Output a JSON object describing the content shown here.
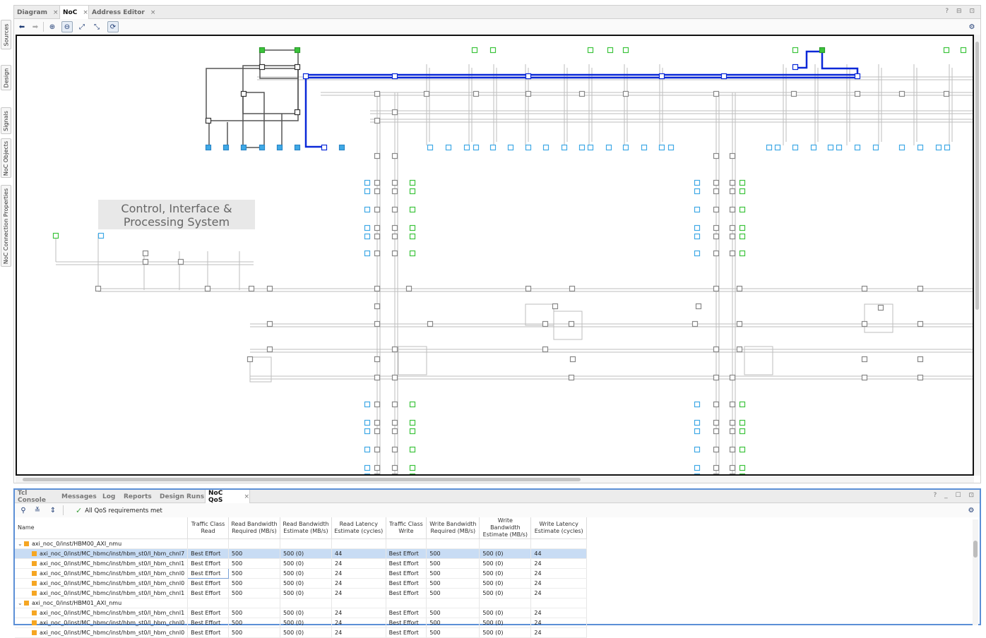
{
  "side_tabs": [
    "Sources",
    "Design",
    "Signals",
    "NoC Objects",
    "NoC Connection Properties"
  ],
  "editor": {
    "tabs": [
      {
        "label": "Diagram",
        "close": "×"
      },
      {
        "label": "NoC",
        "close": "×"
      },
      {
        "label": "Address Editor",
        "close": "×"
      }
    ],
    "window_controls": "? ⊟ ⊡"
  },
  "canvas": {
    "region_label_line1": "Control, Interface &",
    "region_label_line2": "Processing System"
  },
  "bottom_panel": {
    "tabs": [
      {
        "label": "Tcl Console"
      },
      {
        "label": "Messages"
      },
      {
        "label": "Log"
      },
      {
        "label": "Reports"
      },
      {
        "label": "Design Runs"
      },
      {
        "label": "NoC QoS",
        "close": "×"
      }
    ],
    "window_controls": "? _ ☐ ⊡",
    "status": "All QoS requirements met",
    "columns": [
      "Name",
      "Traffic Class Read",
      "Read Bandwidth Required (MB/s)",
      "Read Bandwidth Estimate (MB/s)",
      "Read Latency Estimate (cycles)",
      "Traffic Class Write",
      "Write Bandwidth Required (MB/s)",
      "Write Bandwidth Estimate (MB/s)",
      "Write Latency Estimate (cycles)"
    ],
    "rows": [
      {
        "group": true,
        "name": "axi_noc_0/inst/HBM00_AXI_nmu"
      },
      {
        "name": "axi_noc_0/inst/MC_hbmc/inst/hbm_st0/l_hbm_chnl7",
        "tcr": "Best Effort",
        "rbr": "500",
        "rbe": "500 (0)",
        "rle": "44",
        "tcw": "Best Effort",
        "wbr": "500",
        "wbe": "500 (0)",
        "wle": "44",
        "selected": true
      },
      {
        "name": "axi_noc_0/inst/MC_hbmc/inst/hbm_st0/l_hbm_chnl1",
        "tcr": "Best Effort",
        "rbr": "500",
        "rbe": "500 (0)",
        "rle": "24",
        "tcw": "Best Effort",
        "wbr": "500",
        "wbe": "500 (0)",
        "wle": "24"
      },
      {
        "name": "axi_noc_0/inst/MC_hbmc/inst/hbm_st0/l_hbm_chnl0",
        "tcr": "Best Effort",
        "rbr": "500",
        "rbe": "500 (0)",
        "rle": "24",
        "tcw": "Best Effort",
        "wbr": "500",
        "wbe": "500 (0)",
        "wle": "24",
        "editing": true
      },
      {
        "name": "axi_noc_0/inst/MC_hbmc/inst/hbm_st0/l_hbm_chnl0",
        "tcr": "Best Effort",
        "rbr": "500",
        "rbe": "500 (0)",
        "rle": "24",
        "tcw": "Best Effort",
        "wbr": "500",
        "wbe": "500 (0)",
        "wle": "24"
      },
      {
        "name": "axi_noc_0/inst/MC_hbmc/inst/hbm_st0/l_hbm_chnl1",
        "tcr": "Best Effort",
        "rbr": "500",
        "rbe": "500 (0)",
        "rle": "24",
        "tcw": "Best Effort",
        "wbr": "500",
        "wbe": "500 (0)",
        "wle": "24"
      },
      {
        "group": true,
        "name": "axi_noc_0/inst/HBM01_AXI_nmu"
      },
      {
        "name": "axi_noc_0/inst/MC_hbmc/inst/hbm_st0/l_hbm_chnl1",
        "tcr": "Best Effort",
        "rbr": "500",
        "rbe": "500 (0)",
        "rle": "24",
        "tcw": "Best Effort",
        "wbr": "500",
        "wbe": "500 (0)",
        "wle": "24"
      },
      {
        "name": "axi_noc_0/inst/MC_hbmc/inst/hbm_st0/l_hbm_chnl0",
        "tcr": "Best Effort",
        "rbr": "500",
        "rbe": "500 (0)",
        "rle": "24",
        "tcw": "Best Effort",
        "wbr": "500",
        "wbe": "500 (0)",
        "wle": "24"
      },
      {
        "name": "axi_noc_0/inst/MC_hbmc/inst/hbm_st0/l_hbm_chnl0",
        "tcr": "Best Effort",
        "rbr": "500",
        "rbe": "500 (0)",
        "rle": "24",
        "tcw": "Best Effort",
        "wbr": "500",
        "wbe": "500 (0)",
        "wle": "24"
      }
    ]
  },
  "colors": {
    "route_highlight": "#0a28d8",
    "nmu_green": "#3cc43c",
    "nsu_blue": "#3fa9e6",
    "wire_gray": "#bbbbbb",
    "selected_row": "#c8dcf4",
    "panel_border": "#5b8fd6"
  }
}
